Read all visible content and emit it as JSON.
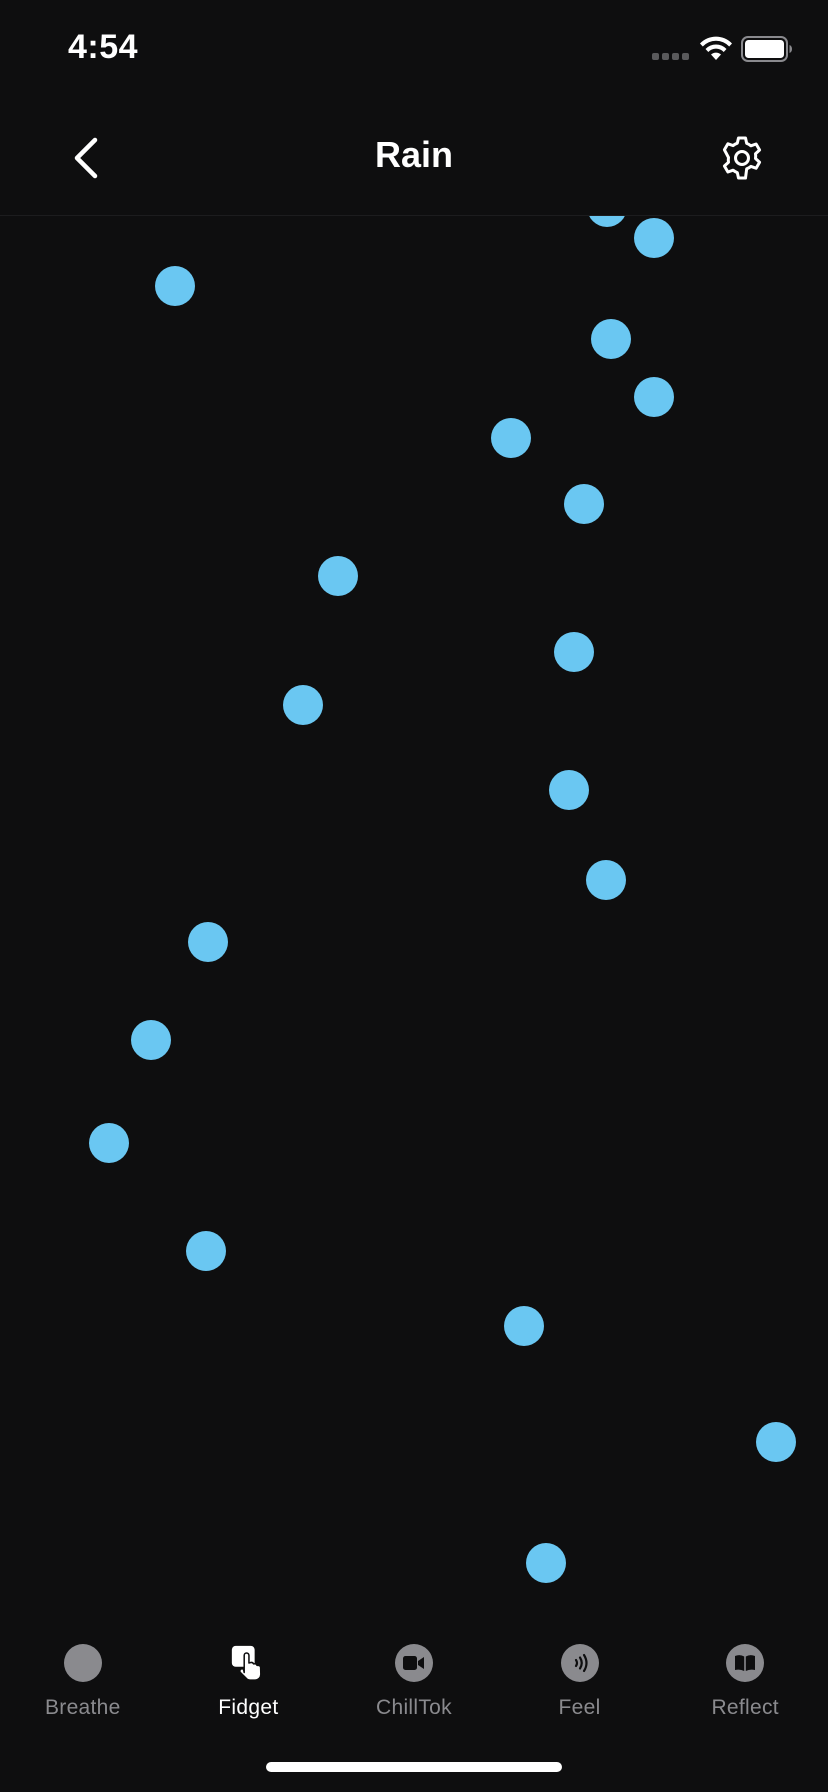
{
  "status_bar": {
    "time": "4:54",
    "signal_icon": "signal-dots-icon",
    "wifi_icon": "wifi-icon",
    "battery_icon": "battery-icon"
  },
  "header": {
    "title": "Rain",
    "back_icon": "chevron-left-icon",
    "settings_icon": "gear-icon"
  },
  "colors": {
    "background": "#0e0e0f",
    "raindrop": "#6ac7f2",
    "tab_inactive": "#8a8a8e",
    "tab_active": "#ffffff"
  },
  "tabs": [
    {
      "label": "Breathe",
      "icon": "circle-icon",
      "active": false
    },
    {
      "label": "Fidget",
      "icon": "touch-hand-icon",
      "active": true
    },
    {
      "label": "ChillTok",
      "icon": "video-camera-icon",
      "active": false
    },
    {
      "label": "Feel",
      "icon": "haptic-waves-icon",
      "active": false
    },
    {
      "label": "Reflect",
      "icon": "book-icon",
      "active": false
    }
  ]
}
